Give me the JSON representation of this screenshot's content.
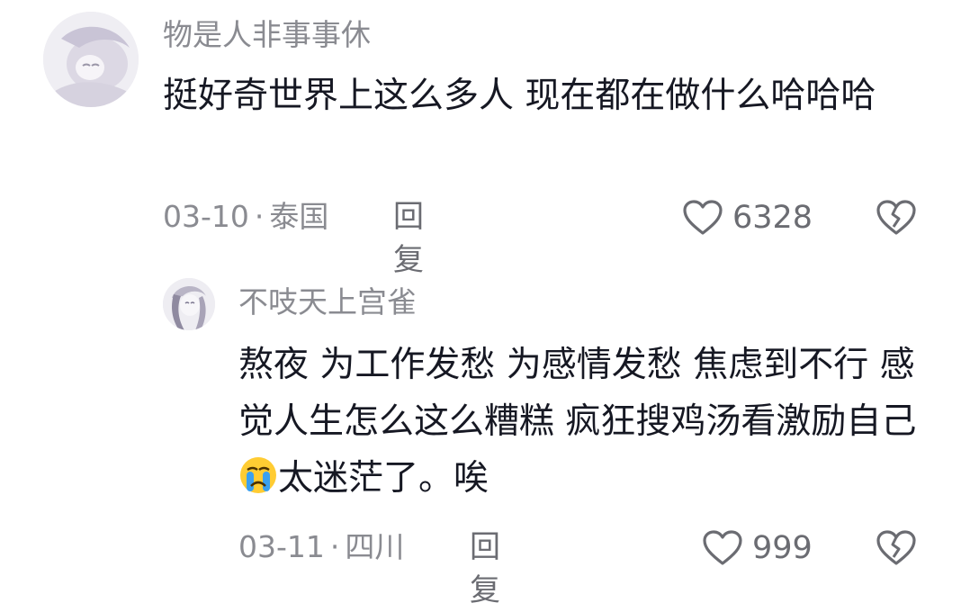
{
  "comments": [
    {
      "username": "物是人非事事休",
      "text": "挺好奇世界上这么多人 现在都在做什么哈哈哈",
      "date": "03-10",
      "location": "泰国",
      "reply_label": "回复",
      "likes": "6328"
    },
    {
      "username": "不吱天上宫雀",
      "text_before_emoji": "熬夜 为工作发愁 为感情发愁 焦虑到不行 感觉人生怎么这么糟糕 疯狂搜鸡汤看激励自己",
      "emoji": "crying-face-emoji",
      "text_after_emoji": "太迷茫了。唉",
      "date": "03-11",
      "location": "四川",
      "reply_label": "回复",
      "likes": "999"
    }
  ],
  "meta_separator": "·",
  "colors": {
    "text": "#161823",
    "secondary": "#8a8b91",
    "icon": "#6b6c72",
    "background": "#ffffff"
  }
}
